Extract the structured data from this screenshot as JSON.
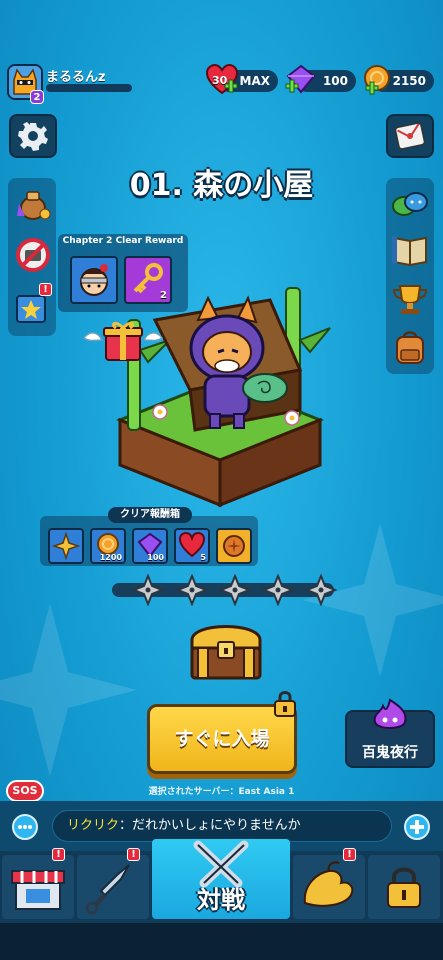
{
  "player": {
    "name": "まるるんz",
    "level": "2"
  },
  "resources": {
    "hearts": "30",
    "hearts_max": "MAX",
    "gems": "100",
    "coins": "2150"
  },
  "stage": {
    "title": "01. 森の小屋"
  },
  "chapter_reward": {
    "label": "Chapter 2 Clear Reward",
    "key_count": "2"
  },
  "clear_reward": {
    "label": "クリア報酬箱",
    "coins": "1200",
    "gems": "100",
    "hearts": "5"
  },
  "enter_button": {
    "label": "すぐに入場"
  },
  "night_parade": {
    "label": "百鬼夜行"
  },
  "server": {
    "text": "選択されたサーバー：East Asia 1"
  },
  "sos": {
    "label": "SOS"
  },
  "chat": {
    "sender": "リクリク",
    "message": "：だれかいしょにやりませんか"
  },
  "nav": {
    "battle_label": "対戦",
    "alert": "!"
  },
  "colors": {
    "background": "#1aa3d6",
    "gold_button": "#f0b51a",
    "alert_red": "#e6283c",
    "gem_purple": "#8a3bd9"
  },
  "icons": {
    "settings": "gear-icon",
    "mail": "mail-icon",
    "lock": "lock-icon",
    "chest": "treasure-chest-icon"
  }
}
